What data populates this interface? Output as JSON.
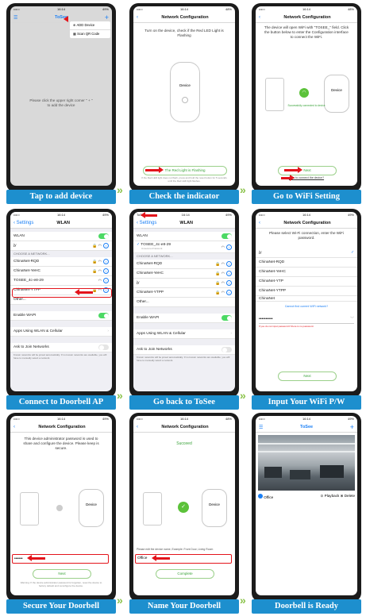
{
  "colors": {
    "label_bg": "#1d8fce",
    "accent_green": "#4cd964",
    "arrow_red": "#e3141b",
    "link_blue": "#1a7ff5"
  },
  "steps": [
    {
      "label": "Tap to add device"
    },
    {
      "label": "Check the indicator"
    },
    {
      "label": "Go to WiFi Setting"
    },
    {
      "label": "Connect to Doorbell AP"
    },
    {
      "label": "Go back to ToSee"
    },
    {
      "label": "Input Your WiFi P/W"
    },
    {
      "label": "Secure Your Doorbell"
    },
    {
      "label": "Name Your Doorbell"
    },
    {
      "label": "Doorbell is Ready"
    }
  ],
  "status": {
    "time": "16:14",
    "battery": "49%",
    "battery2": "48%"
  },
  "s1": {
    "title": "ToSee",
    "menu_add": "ADD Device",
    "menu_scan": "Scan QR Code",
    "hint": "Please click the upper right corner \" + \" to add the device"
  },
  "s2": {
    "title": "Network Configuration",
    "instruction": "Turn on the device, check if the Red LED Light is Flashing",
    "device": "Device",
    "flash_button": "The Red Light is Flashing",
    "footnote": "If the Red LED light does not flash, press and hold the reset button for 5 seconds until the Red LED light flashes."
  },
  "s3": {
    "title": "Network Configuration",
    "instruction": "The device will open WiFi with \"TOSEE_\" field. Click the button below to enter the Configuration interface to connect the WiFi.",
    "device": "Device",
    "connected": "Successfully connected to device",
    "next": "Next",
    "how_link": "How to connect the device?"
  },
  "s4": {
    "back": "Settings",
    "title": "WLAN",
    "wlan": "WLAN",
    "current": "jy",
    "section": "CHOOSE A NETWORK...",
    "networks": [
      "ChinaNet-RQD",
      "ChinaNet-YeHC",
      "TOSEE_4c-e8-29",
      "ChinaNet-YTPP",
      "Other..."
    ],
    "enable_wapi": "Enable WAPI",
    "apps": "Apps Using WLAN & Cellular",
    "ask": "Ask to Join Networks",
    "ask_desc": "Known networks will be joined automatically. If no known networks are available, you will have to manually select a network."
  },
  "s5": {
    "carrier": "ToSee",
    "back": "Settings",
    "title": "WLAN",
    "wlan": "WLAN",
    "current": "TOSEE_4c-e8-29",
    "current_sub": "Unsecured Network",
    "section": "CHOOSE A NETWORK...",
    "networks": [
      "ChinaNet-RQD",
      "ChinaNet-YeHC",
      "jy",
      "ChinaNet-YTPP",
      "Other..."
    ],
    "enable_wapi": "Enable WAPI",
    "apps": "Apps Using WLAN & Cellular",
    "ask": "Ask to Join Networks",
    "ask_desc": "Known networks will be joined automatically. If no known networks are available, you will have to manually select a network."
  },
  "s6": {
    "title": "Network Configuration",
    "instruction": "Please select Wi-Fi connection, enter the WiFi password.",
    "networks": [
      "jy",
      "ChinaNet-RQD",
      "ChinaNet-YeHC",
      "ChinaNet-YTP",
      "ChinaNet-YTPP",
      "ChinaNet"
    ],
    "cannot_find": "Cannot find current WiFi network?",
    "password": "••••••••••",
    "warning": "If you do not input password if there is no password.",
    "next": "Next"
  },
  "s7": {
    "title": "Network Configuration",
    "instruction": "This device administrator password is used to share and configure the device. Please keep is secure.",
    "device": "Device",
    "password": "••••••",
    "next": "Next",
    "warning": "Warning: If the device administrator password is forgotten, reset the device to factory default and reconfigure the device."
  },
  "s8": {
    "title": "Network Configuration",
    "success": "Succeed",
    "device": "Device",
    "name_hint": "Please edit the device name, Example: Front Door, Living Room",
    "name": "Office",
    "complete": "Complete"
  },
  "s9": {
    "title": "ToSee",
    "cam_name": "Office",
    "playback": "Playback",
    "delete": "Delete"
  }
}
